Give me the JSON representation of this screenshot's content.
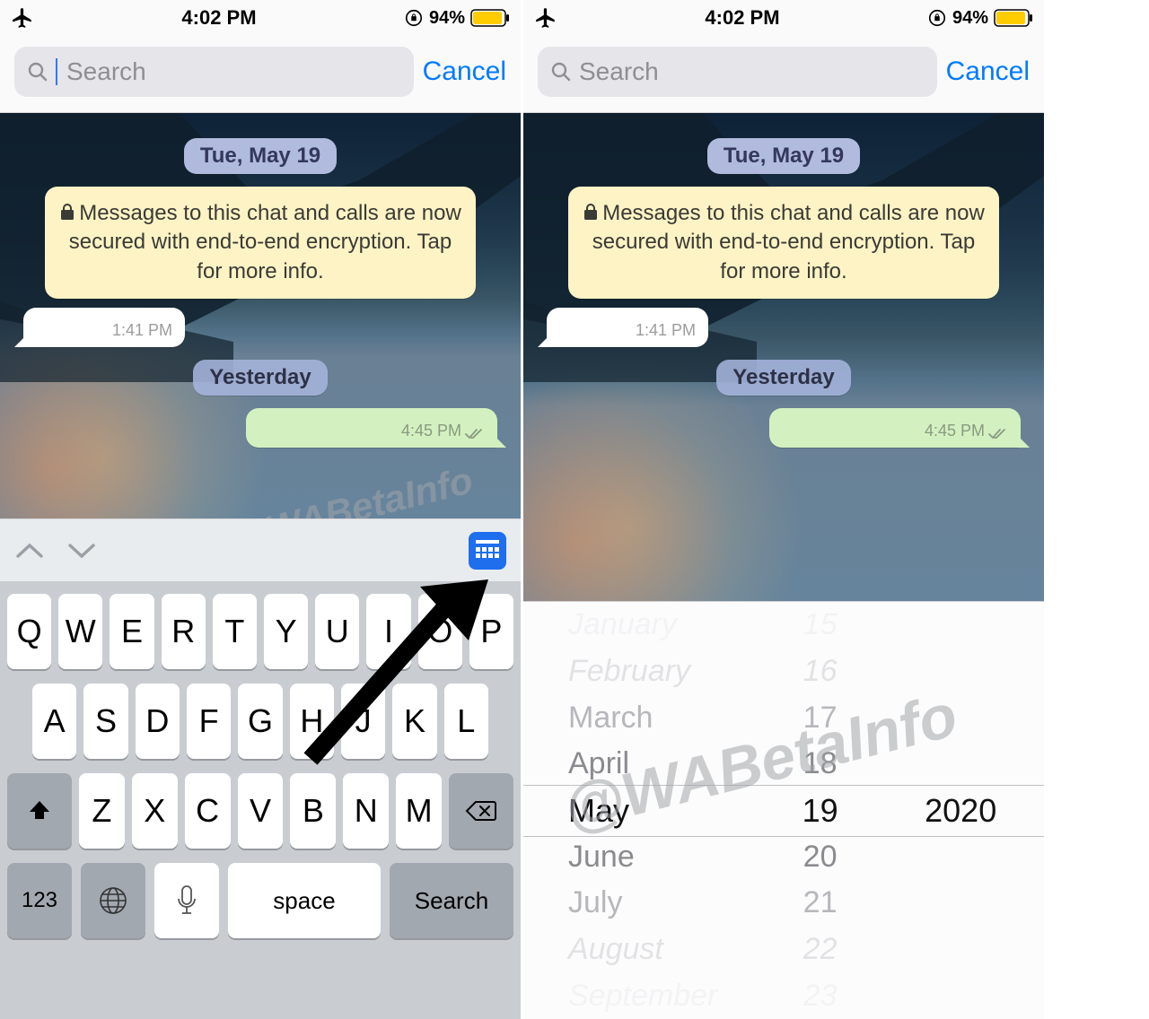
{
  "statusbar": {
    "time": "4:02 PM",
    "battery_pct": "94%"
  },
  "search": {
    "placeholder": "Search",
    "cancel": "Cancel"
  },
  "chat": {
    "date_pill": "Tue, May 19",
    "encryption_notice": "Messages to this chat and calls are now secured with end-to-end encryption. Tap for more info.",
    "incoming_ts": "1:41 PM",
    "day_pill": "Yesterday",
    "outgoing_ts": "4:45 PM"
  },
  "watermark": {
    "text1": "@WABetaInfo",
    "text2": "@WABetaInfo"
  },
  "keyboard": {
    "row1": [
      "Q",
      "W",
      "E",
      "R",
      "T",
      "Y",
      "U",
      "I",
      "O",
      "P"
    ],
    "row2": [
      "A",
      "S",
      "D",
      "F",
      "G",
      "H",
      "J",
      "K",
      "L"
    ],
    "row3": [
      "Z",
      "X",
      "C",
      "V",
      "B",
      "N",
      "M"
    ],
    "k123": "123",
    "space": "space",
    "search": "Search"
  },
  "picker": {
    "months": [
      "January",
      "February",
      "March",
      "April",
      "May",
      "June",
      "July",
      "August",
      "September"
    ],
    "days": [
      "15",
      "16",
      "17",
      "18",
      "19",
      "20",
      "21",
      "22",
      "23"
    ],
    "years": [
      "2020"
    ],
    "selected_index": 4
  }
}
